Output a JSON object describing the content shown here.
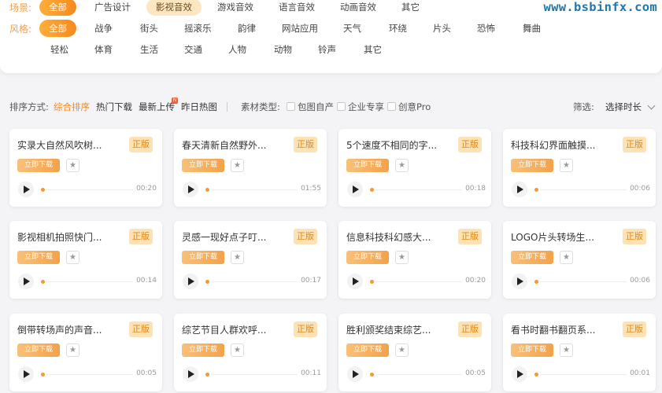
{
  "watermark": "www.bsbinfx.com",
  "filters": {
    "scene": {
      "label": "场景:",
      "options": [
        "全部",
        "广告设计",
        "影视音效",
        "游戏音效",
        "语言音效",
        "动画音效",
        "其它"
      ]
    },
    "style": {
      "label": "风格:",
      "row1": [
        "全部",
        "战争",
        "街头",
        "摇滚乐",
        "韵律",
        "网站应用",
        "天气",
        "环绕",
        "片头",
        "恐怖",
        "舞曲"
      ],
      "row2": [
        "轻松",
        "体育",
        "生活",
        "交通",
        "人物",
        "动物",
        "铃声",
        "其它"
      ]
    }
  },
  "sortbar": {
    "label": "排序方式:",
    "options": [
      "综合排序",
      "热门下载",
      "最新上传",
      "昨日热图"
    ],
    "new_badge": "N",
    "material_label": "素材类型:",
    "material_options": [
      "包图自产",
      "企业专享",
      "创意Pro"
    ],
    "filter_label": "筛选:",
    "duration_select": "选择时长"
  },
  "card_common": {
    "badge": "正版",
    "download": "立即下载",
    "fav_icon": "star-icon",
    "play_icon": "play-icon"
  },
  "cards": [
    {
      "title": "实录大自然风吹树...",
      "duration": "00:20"
    },
    {
      "title": "春天清新自然野外...",
      "duration": "01:55"
    },
    {
      "title": "5个速度不相同的字...",
      "duration": "00:18"
    },
    {
      "title": "科技科幻界面触摸...",
      "duration": "00:06"
    },
    {
      "title": "影视相机拍照快门...",
      "duration": "00:14"
    },
    {
      "title": "灵感一现好点子叮...",
      "duration": "00:17"
    },
    {
      "title": "信息科技科幻感大...",
      "duration": "00:20"
    },
    {
      "title": "LOGO片头转场生...",
      "duration": "00:06"
    },
    {
      "title": "倒带转场声的声音...",
      "duration": "00:05"
    },
    {
      "title": "综艺节目人群欢呼...",
      "duration": "00:11"
    },
    {
      "title": "胜利颁奖结束综艺...",
      "duration": "00:05"
    },
    {
      "title": "看书时翻书翻页系...",
      "duration": "00:01"
    }
  ],
  "colors": {
    "accent": "#f58a1f",
    "badge_bg": "#fde2b5",
    "badge_text": "#e08a1a"
  }
}
